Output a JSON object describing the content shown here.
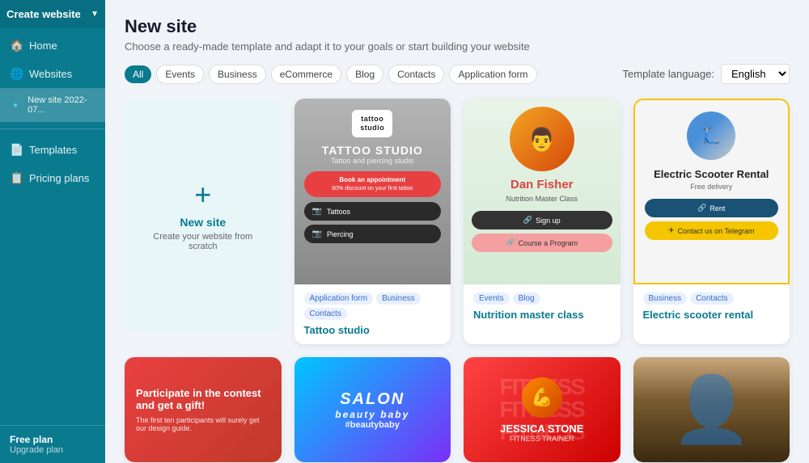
{
  "sidebar": {
    "create_button": "Create website",
    "items": [
      {
        "id": "home",
        "label": "Home",
        "icon": "🏠"
      },
      {
        "id": "websites",
        "label": "Websites",
        "icon": "🌐"
      },
      {
        "id": "current-site",
        "label": "New site 2022-07...",
        "icon": "●"
      },
      {
        "id": "templates",
        "label": "Templates",
        "icon": "📄"
      },
      {
        "id": "pricing",
        "label": "Pricing plans",
        "icon": "📋"
      }
    ],
    "footer": {
      "plan": "Free plan",
      "upgrade": "Upgrade plan"
    }
  },
  "page": {
    "title": "New site",
    "subtitle": "Choose a ready-made template and adapt it to your goals or start building your website"
  },
  "filters": {
    "items": [
      "All",
      "Events",
      "Business",
      "eCommerce",
      "Blog",
      "Contacts",
      "Application form"
    ],
    "active": "All"
  },
  "template_language": {
    "label": "Template language:",
    "value": "English"
  },
  "new_site_card": {
    "label": "New site",
    "description": "Create your website from scratch"
  },
  "templates": [
    {
      "id": "tattoo-studio",
      "name": "Tattoo studio",
      "tags": [
        "Application form",
        "Business",
        "Contacts"
      ],
      "preview_type": "tattoo"
    },
    {
      "id": "nutrition-master-class",
      "name": "Nutrition master class",
      "tags": [
        "Events",
        "Blog"
      ],
      "preview_type": "nutrition"
    },
    {
      "id": "electric-scooter-rental",
      "name": "Electric scooter rental",
      "tags": [
        "Business",
        "Contacts"
      ],
      "preview_type": "scooter"
    }
  ],
  "bottom_templates": [
    {
      "id": "contest",
      "type": "contest",
      "title": "Participate in the contest and get a gift!",
      "subtitle": "The first ten participants will surely get our design guide."
    },
    {
      "id": "beauty-salon",
      "type": "beauty",
      "title": "SALON",
      "subtitle": "#beautybaby"
    },
    {
      "id": "fitness",
      "type": "fitness",
      "name": "JESSICA STONE",
      "role": "FITNESS TRAINER"
    },
    {
      "id": "portrait",
      "type": "portrait"
    }
  ],
  "tattoo_preview": {
    "logo": "tattoo\nstudio",
    "title": "TATTOO STUDIO",
    "subtitle": "Tattoo and piercing studio",
    "cta": "Book an appointment\n60% discount on your first tattoo",
    "btn1": "Tattoos",
    "btn2": "Piercing"
  },
  "nutrition_preview": {
    "name": "Dan Fisher",
    "class": "Nutrition Master Class",
    "btn_signup": "Sign up",
    "btn_course": "Course a Program"
  },
  "scooter_preview": {
    "title": "Electric Scooter Rental",
    "subtitle": "Free delivery",
    "btn_rent": "Rent",
    "btn_telegram": "Contact us on Telegram"
  }
}
